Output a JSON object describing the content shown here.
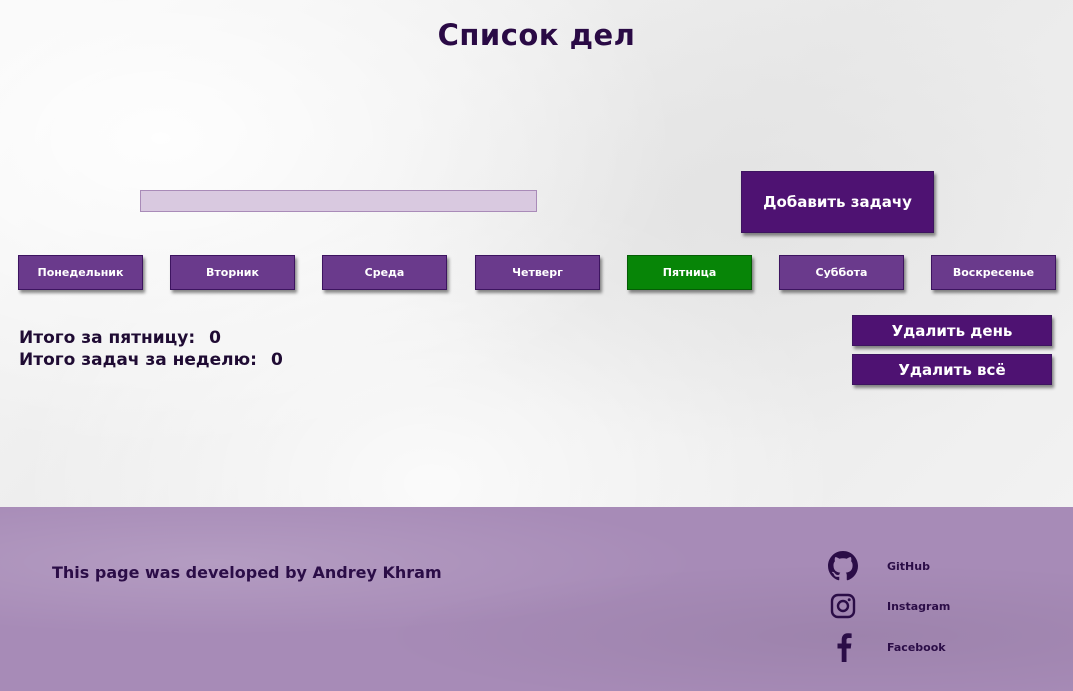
{
  "header": {
    "title": "Список дел"
  },
  "task_form": {
    "input_value": "",
    "input_placeholder": "",
    "add_button_label": "Добавить задачу"
  },
  "days": [
    {
      "label": "Понедельник",
      "active": false
    },
    {
      "label": "Вторник",
      "active": false
    },
    {
      "label": "Среда",
      "active": false
    },
    {
      "label": "Четверг",
      "active": false
    },
    {
      "label": "Пятница",
      "active": true
    },
    {
      "label": "Суббота",
      "active": false
    },
    {
      "label": "Воскресенье",
      "active": false
    }
  ],
  "summary": {
    "day_total_label": "Итого за пятницу:",
    "day_total_value": "0",
    "week_total_label": "Итого задач за неделю:",
    "week_total_value": "0"
  },
  "actions": {
    "delete_day_label": "Удалить день",
    "delete_all_label": "Удалить всё"
  },
  "footer": {
    "credit": "This page was developed by Andrey Khram",
    "links": [
      {
        "label": "GitHub",
        "icon": "github-icon"
      },
      {
        "label": "Instagram",
        "icon": "instagram-icon"
      },
      {
        "label": "Facebook",
        "icon": "facebook-icon"
      }
    ]
  },
  "colors": {
    "primary": "#4e1272",
    "day_button": "#6a3a8c",
    "active_day": "#078507",
    "footer_bg": "#a78bb7",
    "text_dark": "#2a0a45"
  }
}
